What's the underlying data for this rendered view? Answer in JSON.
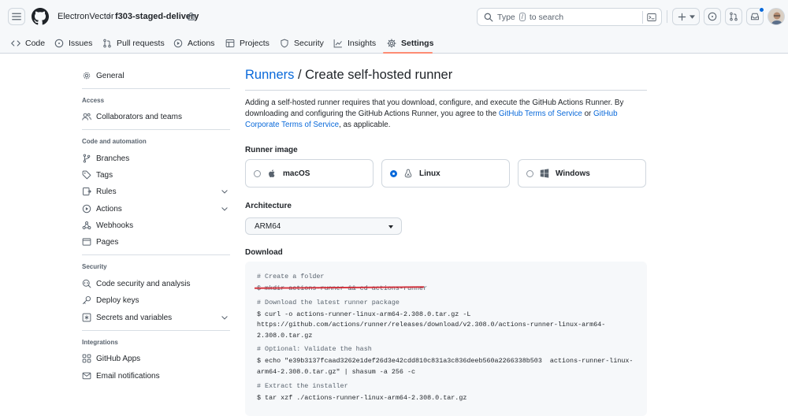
{
  "header": {
    "owner": "ElectronVector",
    "separator": "/",
    "repo": "f303-staged-delivery",
    "search_prefix": "Type",
    "search_key": "/",
    "search_suffix": "to search"
  },
  "tabs": [
    {
      "label": "Code",
      "icon": "code-icon"
    },
    {
      "label": "Issues",
      "icon": "issue-icon"
    },
    {
      "label": "Pull requests",
      "icon": "pull-request-icon"
    },
    {
      "label": "Actions",
      "icon": "play-icon"
    },
    {
      "label": "Projects",
      "icon": "table-icon"
    },
    {
      "label": "Security",
      "icon": "shield-icon"
    },
    {
      "label": "Insights",
      "icon": "graph-icon"
    },
    {
      "label": "Settings",
      "icon": "gear-icon",
      "selected": true
    }
  ],
  "sidebar": {
    "general": "General",
    "access_heading": "Access",
    "collaborators": "Collaborators and teams",
    "code_automation_heading": "Code and automation",
    "branches": "Branches",
    "tags": "Tags",
    "rules": "Rules",
    "actions": "Actions",
    "webhooks": "Webhooks",
    "pages": "Pages",
    "security_heading": "Security",
    "code_security": "Code security and analysis",
    "deploy_keys": "Deploy keys",
    "secrets": "Secrets and variables",
    "integrations_heading": "Integrations",
    "github_apps": "GitHub Apps",
    "email_notifications": "Email notifications"
  },
  "main": {
    "title_link": "Runners",
    "title_rest": " / Create self-hosted runner",
    "intro_1": "Adding a self-hosted runner requires that you download, configure, and execute the GitHub Actions Runner. By downloading and configuring the GitHub Actions Runner, you agree to the ",
    "intro_link_1": "GitHub Terms of Service",
    "intro_or": " or ",
    "intro_link_2": "GitHub Corporate Terms of Service",
    "intro_end": ", as applicable.",
    "runner_image_label": "Runner image",
    "images": [
      {
        "label": "macOS",
        "selected": false,
        "icon": "apple-icon"
      },
      {
        "label": "Linux",
        "selected": true,
        "icon": "linux-icon"
      },
      {
        "label": "Windows",
        "selected": false,
        "icon": "windows-icon"
      }
    ],
    "architecture_label": "Architecture",
    "architecture_value": "ARM64",
    "download_label": "Download",
    "code_lines": [
      "# Create a folder",
      "$ mkdir actions-runner && cd actions-runner",
      "# Download the latest runner package",
      "$ curl -o actions-runner-linux-arm64-2.308.0.tar.gz -L",
      "https://github.com/actions/runner/releases/download/v2.308.0/actions-runner-linux-arm64-",
      "2.308.0.tar.gz",
      "# Optional: Validate the hash",
      "$ echo \"e39b3137fcaad3262e1def26d3e42cdd810c831a3c836deeb560a2266338b503  actions-runner-linux-",
      "arm64-2.308.0.tar.gz\" | shasum -a 256 -c",
      "# Extract the installer",
      "$ tar xzf ./actions-runner-linux-arm64-2.308.0.tar.gz"
    ]
  },
  "colors": {
    "link": "#0969da",
    "tab_underline": "#fd8c73",
    "strike_annotation": "#d1242f"
  }
}
